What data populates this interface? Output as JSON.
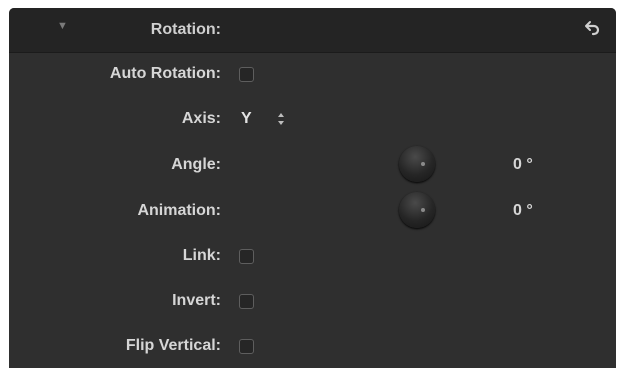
{
  "header": {
    "title": "Rotation:",
    "collapse_glyph": "▼",
    "reset_icon": "reset-arrow-icon"
  },
  "rows": {
    "auto_rotation": {
      "label": "Auto Rotation:",
      "checked": false
    },
    "axis": {
      "label": "Axis:",
      "value": "Y"
    },
    "angle": {
      "label": "Angle:",
      "value": "0 °"
    },
    "animation": {
      "label": "Animation:",
      "value": "0 °"
    },
    "link": {
      "label": "Link:",
      "checked": false
    },
    "invert": {
      "label": "Invert:",
      "checked": false
    },
    "flip_vertical": {
      "label": "Flip Vertical:",
      "checked": false
    }
  },
  "colors": {
    "panel_bg": "#2f2f2f",
    "header_bg": "#242424",
    "text": "#d6d6d6"
  }
}
